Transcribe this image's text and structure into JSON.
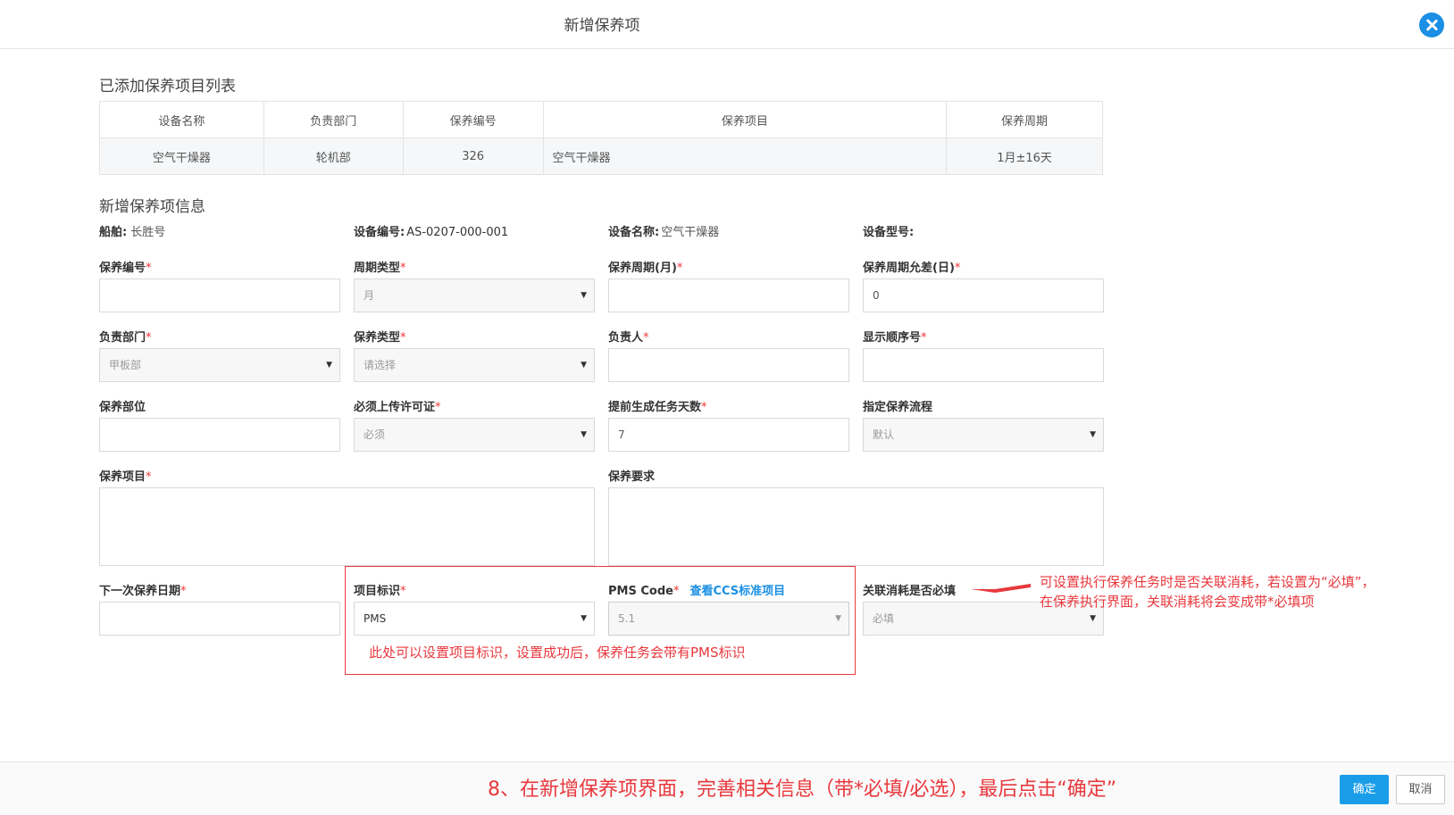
{
  "dialog": {
    "title": "新增保养项"
  },
  "list_section": {
    "title": "已添加保养项目列表",
    "columns": [
      "设备名称",
      "负责部门",
      "保养编号",
      "保养项目",
      "保养周期"
    ],
    "rows": [
      [
        "空气干燥器",
        "轮机部",
        "326",
        "空气干燥器",
        "1月±16天"
      ]
    ]
  },
  "form_section": {
    "title": "新增保养项信息",
    "info": {
      "ship_label": "船舶:",
      "ship_value": "长胜号",
      "device_no_label": "设备编号:",
      "device_no_value": "AS-0207-000-001",
      "device_name_label": "设备名称:",
      "device_name_value": "空气干燥器",
      "device_model_label": "设备型号:"
    },
    "fields": {
      "maint_no": {
        "label": "保养编号",
        "value": ""
      },
      "cycle_type": {
        "label": "周期类型",
        "value": "月"
      },
      "cycle_months": {
        "label": "保养周期(月)",
        "value": ""
      },
      "cycle_tolerance": {
        "label": "保养周期允差(日)",
        "value": "0"
      },
      "dept": {
        "label": "负责部门",
        "value": "甲板部"
      },
      "maint_type": {
        "label": "保养类型",
        "value": "请选择"
      },
      "owner": {
        "label": "负责人",
        "value": ""
      },
      "order_no": {
        "label": "显示顺序号",
        "value": ""
      },
      "part": {
        "label": "保养部位",
        "value": ""
      },
      "permit": {
        "label": "必须上传许可证",
        "value": "必须"
      },
      "advance_days": {
        "label": "提前生成任务天数",
        "value": "7"
      },
      "flow": {
        "label": "指定保养流程",
        "value": "默认"
      },
      "item": {
        "label": "保养项目",
        "value": ""
      },
      "requirement": {
        "label": "保养要求",
        "value": ""
      },
      "next_date": {
        "label": "下一次保养日期",
        "value": ""
      },
      "item_tag": {
        "label": "项目标识",
        "value": "PMS"
      },
      "pms_code": {
        "label": "PMS Code",
        "value": "5.1",
        "link": "查看CCS标准项目"
      },
      "consume_required": {
        "label": "关联消耗是否必填",
        "value": "必填"
      }
    },
    "required_mark": "*"
  },
  "annotations": {
    "pms_note": "此处可以设置项目标识，设置成功后，保养任务会带有PMS标识",
    "consume_note_1": "可设置执行保养任务时是否关联消耗，若设置为“必填”，",
    "consume_note_2": "在保养执行界面，关联消耗将会变成带*必填项",
    "step_note": "8、在新增保养项界面，完善相关信息（带*必填/必选），最后点击“确定”"
  },
  "footer": {
    "ok_label": "确定",
    "cancel_label": "取消"
  },
  "colors": {
    "accent": "#1a9de8",
    "annotation": "#e8383d"
  },
  "icons": {
    "close": "close-icon",
    "dropdown": "chevron-down-icon"
  }
}
